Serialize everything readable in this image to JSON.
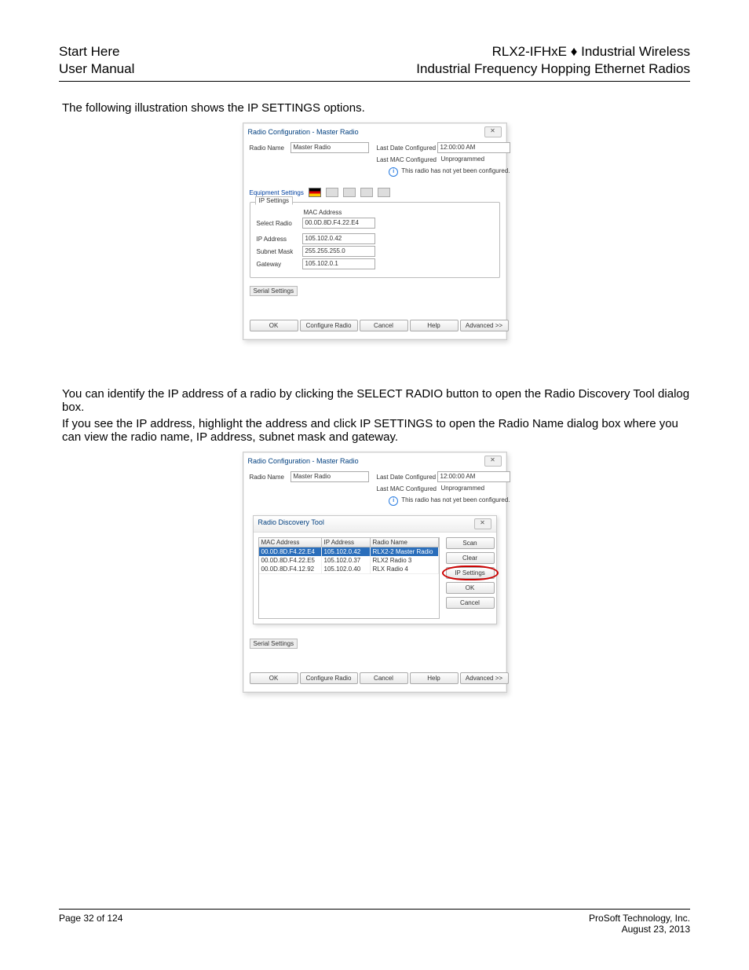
{
  "page": {
    "header_left_line1": "Start Here",
    "header_left_line2": "User Manual",
    "header_right_line1": "RLX2-IFHxE ♦ Industrial Wireless",
    "header_right_line2": "Industrial Frequency Hopping Ethernet Radios",
    "intro_text": "The following illustration shows the IP SETTINGS options.",
    "mid_text_1": "You can identify the IP address of a radio by clicking the SELECT RADIO button to open the Radio Discovery Tool dialog box.",
    "mid_text_2": "If you see the IP address, highlight the address and click IP SETTINGS to open the Radio Name dialog box where you can view the radio name, IP address, subnet mask and gateway.",
    "footer_left": "Page 32 of 124",
    "footer_right_line1": "ProSoft Technology, Inc.",
    "footer_right_line2": "August 23, 2013"
  },
  "dialog1": {
    "title": "Radio Configuration - Master Radio",
    "close_glyph": "✕",
    "radio_name_label": "Radio Name",
    "radio_name_value": "Master Radio",
    "last_date_label": "Last Date Configured",
    "last_date_value": "12:00:00 AM",
    "last_mac_label": "Last MAC Configured",
    "last_mac_value": "Unprogrammed",
    "status_text": "This radio has not yet been configured.",
    "equipment_settings_label": "Equipment Settings",
    "ip_tab": "IP Settings",
    "mac_label": "MAC Address",
    "select_radio_label": "Select Radio",
    "mac_value": "00.0D.8D.F4.22.E4",
    "ip_addr_label": "IP Address",
    "ip_addr_value": "105.102.0.42",
    "subnet_label": "Subnet Mask",
    "subnet_value": "255.255.255.0",
    "gateway_label": "Gateway",
    "gateway_value": "105.102.0.1",
    "serial_tab": "Serial Settings",
    "btn_ok": "OK",
    "btn_configure": "Configure Radio",
    "btn_cancel": "Cancel",
    "btn_help": "Help",
    "btn_advanced": "Advanced >>"
  },
  "dialog2": {
    "title": "Radio Configuration - Master Radio",
    "close_glyph": "✕",
    "radio_name_label": "Radio Name",
    "radio_name_value": "Master Radio",
    "last_date_label": "Last Date Configured",
    "last_date_value": "12:00:00 AM",
    "last_mac_label": "Last MAC Configured",
    "last_mac_value": "Unprogrammed",
    "status_text": "This radio has not yet been configured.",
    "inner_title": "Radio Discovery Tool",
    "inner_close": "✕",
    "col_mac": "MAC Address",
    "col_ip": "IP Address",
    "col_name": "Radio Name",
    "rows": [
      {
        "mac": "00.0D.8D.F4.22.E4",
        "ip": "105.102.0.42",
        "name": "RLX2-2 Master Radio"
      },
      {
        "mac": "00.0D.8D.F4.22.E5",
        "ip": "105.102.0.37",
        "name": "RLX2 Radio 3"
      },
      {
        "mac": "00.0D.8D.F4.12.92",
        "ip": "105.102.0.40",
        "name": "RLX Radio 4"
      }
    ],
    "btn_scan": "Scan",
    "btn_clear": "Clear",
    "btn_ipsettings": "IP Settings",
    "btn_inner_ok": "OK",
    "btn_inner_cancel": "Cancel",
    "serial_tab": "Serial Settings",
    "btn_ok": "OK",
    "btn_configure": "Configure Radio",
    "btn_cancel": "Cancel",
    "btn_help": "Help",
    "btn_advanced": "Advanced >>"
  }
}
